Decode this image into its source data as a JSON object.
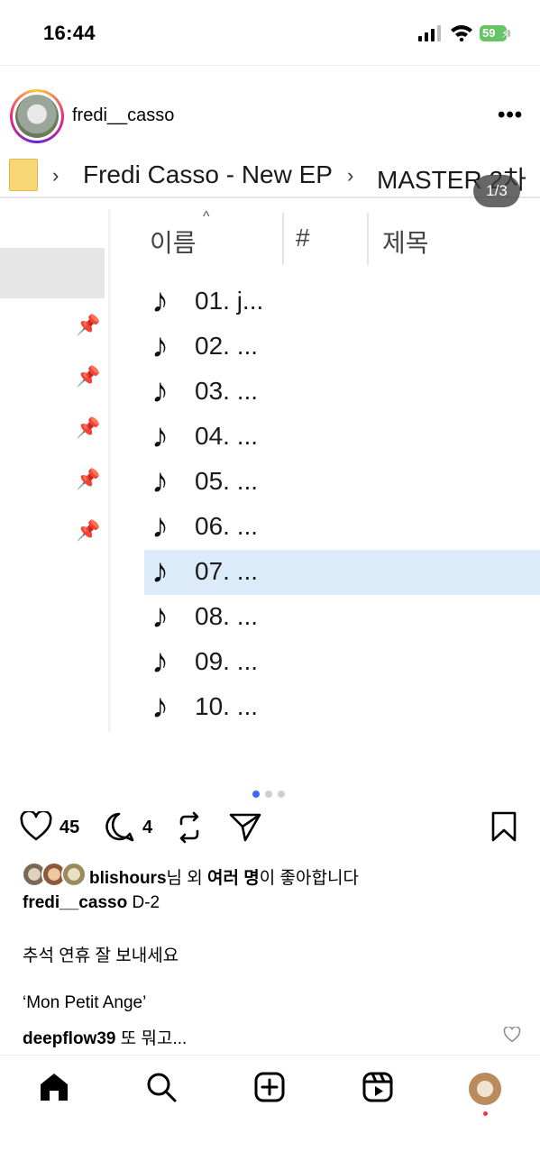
{
  "status_bar": {
    "time": "16:44",
    "battery": "59"
  },
  "post": {
    "username": "fredi__casso",
    "counter": "1/3",
    "likes_count": "45",
    "comments_count": "4"
  },
  "explorer": {
    "breadcrumbs": [
      "Fredi Casso - New EP",
      "MASTER 2차"
    ],
    "columns": {
      "name": "이름",
      "number": "#",
      "title": "제목"
    },
    "files": [
      "01. j...",
      "02. ...",
      "03. ...",
      "04. ...",
      "05. ...",
      "06. ...",
      "07. ...",
      "08. ...",
      "09. ...",
      "10. ..."
    ],
    "selected_index": 6
  },
  "likes_line": {
    "user": "blishours",
    "text_mid": "님 외 ",
    "bold_part": "여러 명",
    "text_end": "이 좋아합니다"
  },
  "caption": {
    "user": "fredi__casso",
    "line1": "D-2",
    "line2": "추석 연휴 잘 보내세요",
    "line3": "‘Mon Petit Ange’"
  },
  "comment": {
    "user": "deepflow39",
    "text": "또 뭐고..."
  },
  "icons": {
    "like": "heart-icon",
    "comment": "comment-icon",
    "repost": "repost-icon",
    "share": "send-icon",
    "save": "bookmark-icon",
    "nav": [
      "home-icon",
      "search-icon",
      "create-icon",
      "reels-icon",
      "profile-avatar"
    ]
  },
  "colors": {
    "selection": "#dcebf9",
    "accent_dot": "#3b6cf6",
    "notification": "#ff3040"
  }
}
